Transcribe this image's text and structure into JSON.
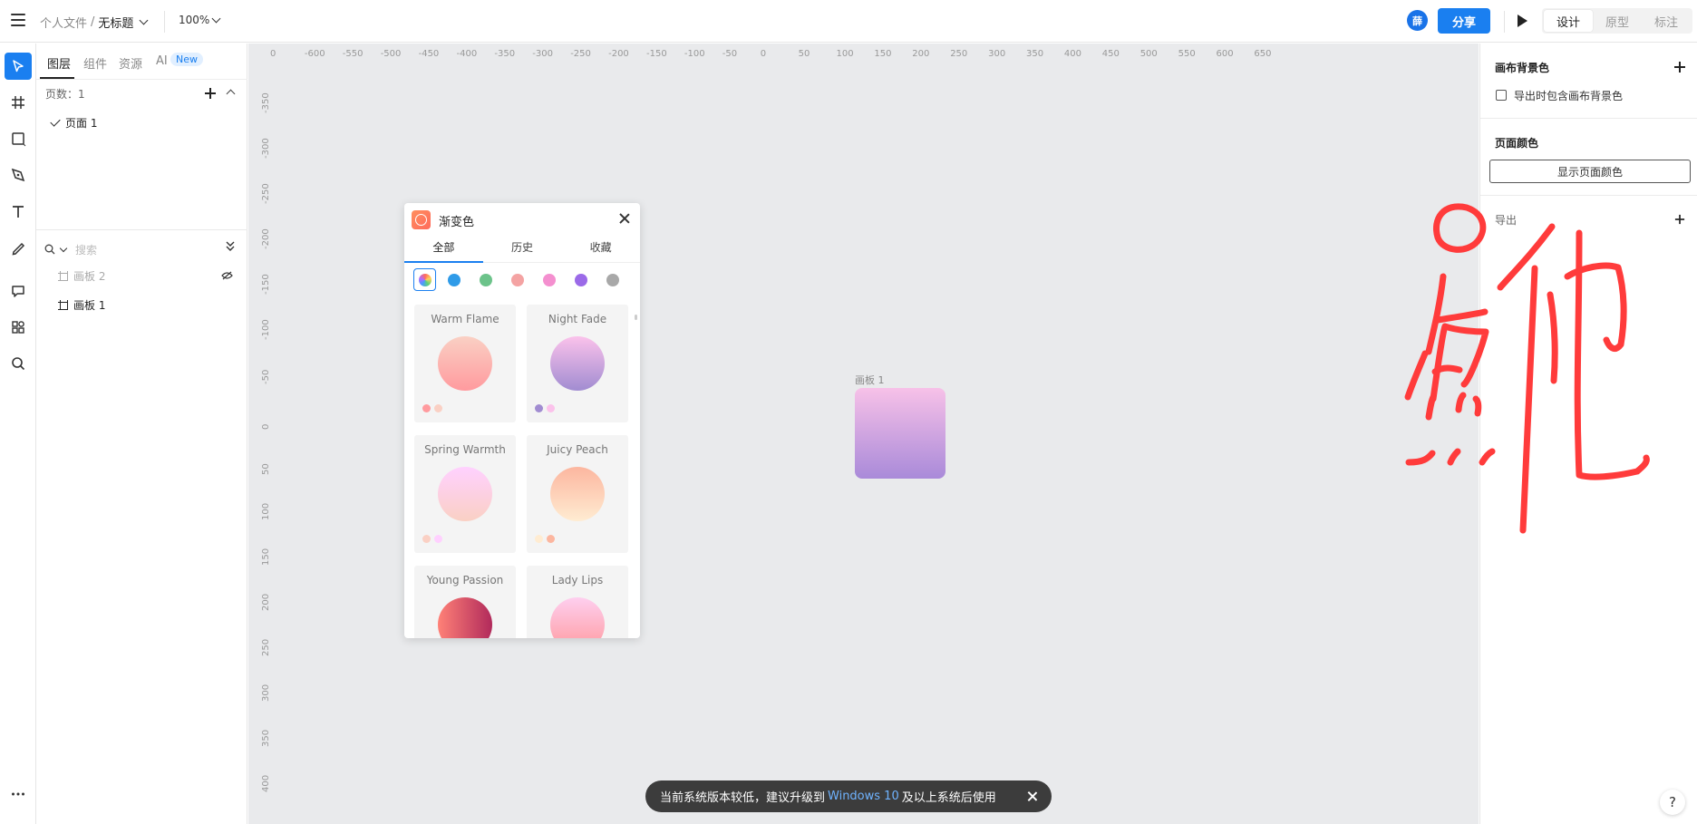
{
  "topbar": {
    "breadcrumb_folder": "个人文件",
    "breadcrumb_sep": "/",
    "doc_title": "无标题",
    "zoom": "100%",
    "avatar_text": "薛",
    "share_label": "分享",
    "mode_tabs": [
      "设计",
      "原型",
      "标注"
    ]
  },
  "layers_panel": {
    "tabs": [
      "图层",
      "组件",
      "资源",
      "AI"
    ],
    "new_badge": "New",
    "pages_count": "页数：1",
    "pages": [
      "页面 1"
    ],
    "search_placeholder": "搜索",
    "layers": [
      "画板 2",
      "画板 1"
    ]
  },
  "canvas": {
    "h_ticks": [
      "0",
      "-600",
      "-550",
      "-500",
      "-450",
      "-400",
      "-350",
      "-300",
      "-250",
      "-200",
      "-150",
      "-100",
      "-50",
      "0",
      "50",
      "100",
      "150",
      "200",
      "250",
      "300",
      "350",
      "400",
      "450",
      "500",
      "550",
      "600",
      "650"
    ],
    "v_ticks": [
      "-350",
      "-300",
      "-250",
      "-200",
      "-150",
      "-100",
      "-50",
      "0",
      "50",
      "100",
      "150",
      "200",
      "250",
      "300",
      "350",
      "400"
    ],
    "artboard_label": "画板 1",
    "artboard_colors": [
      "#f7c1e8",
      "#a98ad9"
    ]
  },
  "gradient_dialog": {
    "title": "渐变色",
    "tabs": [
      "全部",
      "历史",
      "收藏"
    ],
    "swatches": [
      "#2f9be8",
      "#6cc38a",
      "#f4a3a3",
      "#f48fcf",
      "#9b6ae8",
      "#a8a8a8"
    ],
    "cards": [
      {
        "name": "Warm Flame",
        "colors": [
          "#ff9a9e",
          "#fad0c4"
        ]
      },
      {
        "name": "Night Fade",
        "colors": [
          "#a18cd1",
          "#fbc2eb"
        ]
      },
      {
        "name": "Spring Warmth",
        "colors": [
          "#fad0c4",
          "#ffd1ff"
        ]
      },
      {
        "name": "Juicy Peach",
        "colors": [
          "#ffecd2",
          "#fcb69f"
        ]
      },
      {
        "name": "Young Passion",
        "colors": [
          "#ff8177",
          "#b12a5b"
        ]
      },
      {
        "name": "Lady Lips",
        "colors": [
          "#ff9a9e",
          "#fecfef"
        ]
      }
    ]
  },
  "toast": {
    "text_before": "当前系统版本较低，建议升级到",
    "link": "Windows 10",
    "text_after": "及以上系统后使用"
  },
  "right_panel": {
    "canvas_bg_title": "画布背景色",
    "export_bg_label": "导出时包含画布背景色",
    "page_color_title": "页面颜色",
    "show_page_color_btn": "显示页面颜色",
    "export_title": "导出",
    "help": "?"
  },
  "annotation": {
    "text": "点他",
    "color": "#ff3b3b"
  }
}
